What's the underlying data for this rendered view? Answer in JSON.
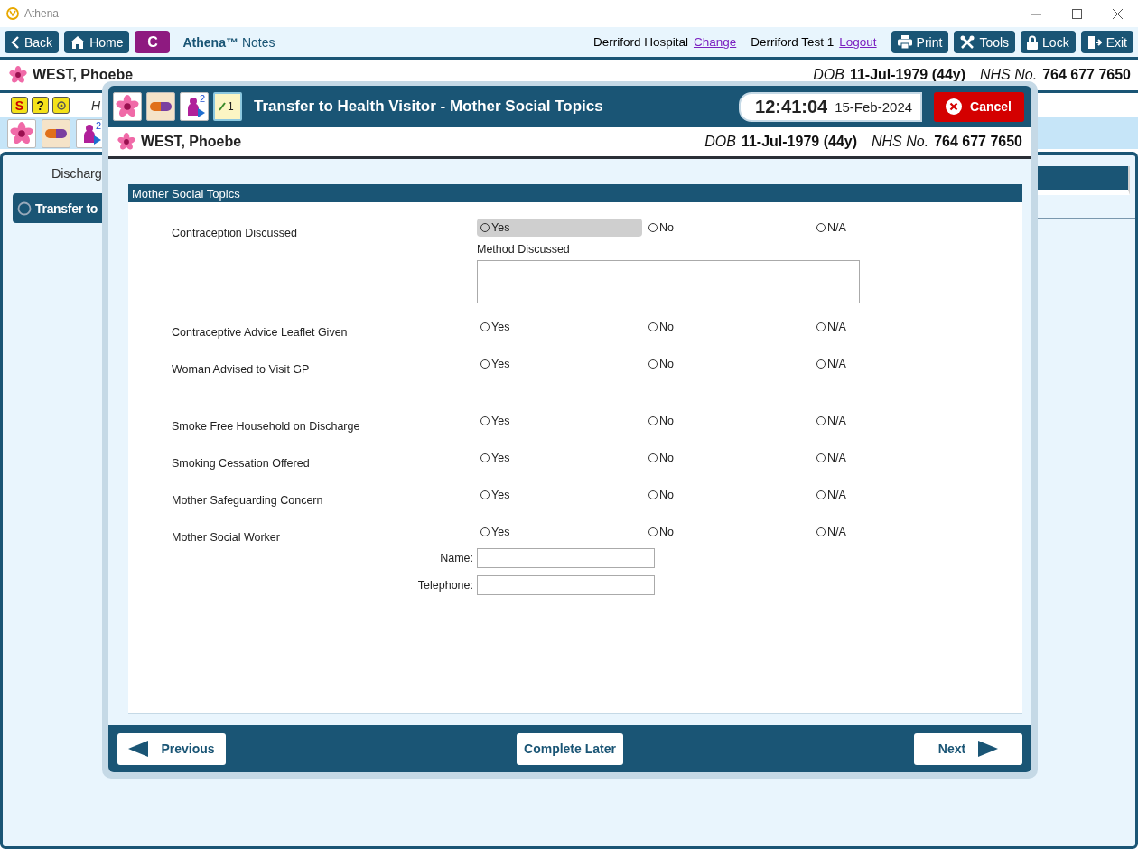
{
  "window": {
    "title": "Athena"
  },
  "toolbar": {
    "nav_buttons": [
      {
        "kind": "back",
        "label": "Back"
      },
      {
        "kind": "home",
        "label": "Home"
      },
      {
        "kind": "letter",
        "label": "C"
      }
    ],
    "app_name": "Athena™",
    "app_section": "Notes",
    "hospital": "Derriford Hospital",
    "change_link": "Change",
    "user": "Derriford Test 1",
    "logout_link": "Logout",
    "actions": [
      {
        "kind": "print",
        "label": "Print"
      },
      {
        "kind": "tools",
        "label": "Tools"
      },
      {
        "kind": "lock",
        "label": "Lock"
      },
      {
        "kind": "exit",
        "label": "Exit"
      }
    ]
  },
  "patient": {
    "name": "WEST, Phoebe",
    "dob_label": "DOB",
    "dob": "11-Jul-1979 (44y)",
    "nhs_label": "NHS No.",
    "nhs": "764 677 7650"
  },
  "quick_icons": [
    {
      "kind": "alert",
      "glyph": "S"
    },
    {
      "kind": "help",
      "glyph": "?"
    },
    {
      "kind": "settings"
    }
  ],
  "partial_heading": "H",
  "tile_icons": [
    {
      "kind": "flower"
    },
    {
      "kind": "pill"
    },
    {
      "kind": "baby",
      "count": "2"
    }
  ],
  "sidebar": {
    "heading": "Discharg",
    "item": "Transfer to"
  },
  "dialog": {
    "tile_icons": [
      {
        "kind": "flower"
      },
      {
        "kind": "pill"
      },
      {
        "kind": "baby",
        "count": "2"
      },
      {
        "kind": "notes",
        "count": "1"
      }
    ],
    "title": "Transfer to Health Visitor - Mother Social Topics",
    "time": "12:41:04",
    "date": "15-Feb-2024",
    "cancel": "Cancel",
    "patient": {
      "name": "WEST, Phoebe",
      "dob_label": "DOB",
      "dob": "11-Jul-1979 (44y)",
      "nhs_label": "NHS No.",
      "nhs": "764 677 7650"
    },
    "section_title": "Mother Social Topics",
    "question_groups": [
      [
        {
          "label": "Contraception Discussed",
          "options": [
            {
              "label": "Yes",
              "selected": false,
              "highlighted": true
            },
            {
              "label": "No",
              "selected": false,
              "highlighted": false
            },
            {
              "label": "N/A",
              "selected": false,
              "highlighted": false
            }
          ],
          "details": [
            {
              "kind": "textarea",
              "label": "Method Discussed"
            }
          ]
        },
        {
          "label": "Contraceptive Advice Leaflet Given",
          "options": [
            {
              "label": "Yes",
              "selected": false,
              "highlighted": false
            },
            {
              "label": "No",
              "selected": false,
              "highlighted": false
            },
            {
              "label": "N/A",
              "selected": false,
              "highlighted": false
            }
          ]
        },
        {
          "label": "Woman Advised to Visit GP",
          "options": [
            {
              "label": "Yes",
              "selected": false,
              "highlighted": false
            },
            {
              "label": "No",
              "selected": false,
              "highlighted": false
            },
            {
              "label": "N/A",
              "selected": false,
              "highlighted": false
            }
          ]
        }
      ],
      [
        {
          "label": "Smoke Free Household on Discharge",
          "options": [
            {
              "label": "Yes",
              "selected": false,
              "highlighted": false
            },
            {
              "label": "No",
              "selected": false,
              "highlighted": false
            },
            {
              "label": "N/A",
              "selected": false,
              "highlighted": false
            }
          ]
        },
        {
          "label": "Smoking Cessation Offered",
          "options": [
            {
              "label": "Yes",
              "selected": false,
              "highlighted": false
            },
            {
              "label": "No",
              "selected": false,
              "highlighted": false
            },
            {
              "label": "N/A",
              "selected": false,
              "highlighted": false
            }
          ]
        },
        {
          "label": "Mother Safeguarding Concern",
          "options": [
            {
              "label": "Yes",
              "selected": false,
              "highlighted": false
            },
            {
              "label": "No",
              "selected": false,
              "highlighted": false
            },
            {
              "label": "N/A",
              "selected": false,
              "highlighted": false
            }
          ]
        },
        {
          "label": "Mother Social Worker",
          "options": [
            {
              "label": "Yes",
              "selected": false,
              "highlighted": false
            },
            {
              "label": "No",
              "selected": false,
              "highlighted": false
            },
            {
              "label": "N/A",
              "selected": false,
              "highlighted": false
            }
          ],
          "details": [
            {
              "kind": "text",
              "label": "Name:"
            },
            {
              "kind": "text",
              "label": "Telephone:"
            }
          ]
        }
      ]
    ],
    "footer": {
      "previous": "Previous",
      "later": "Complete Later",
      "next": "Next"
    }
  }
}
